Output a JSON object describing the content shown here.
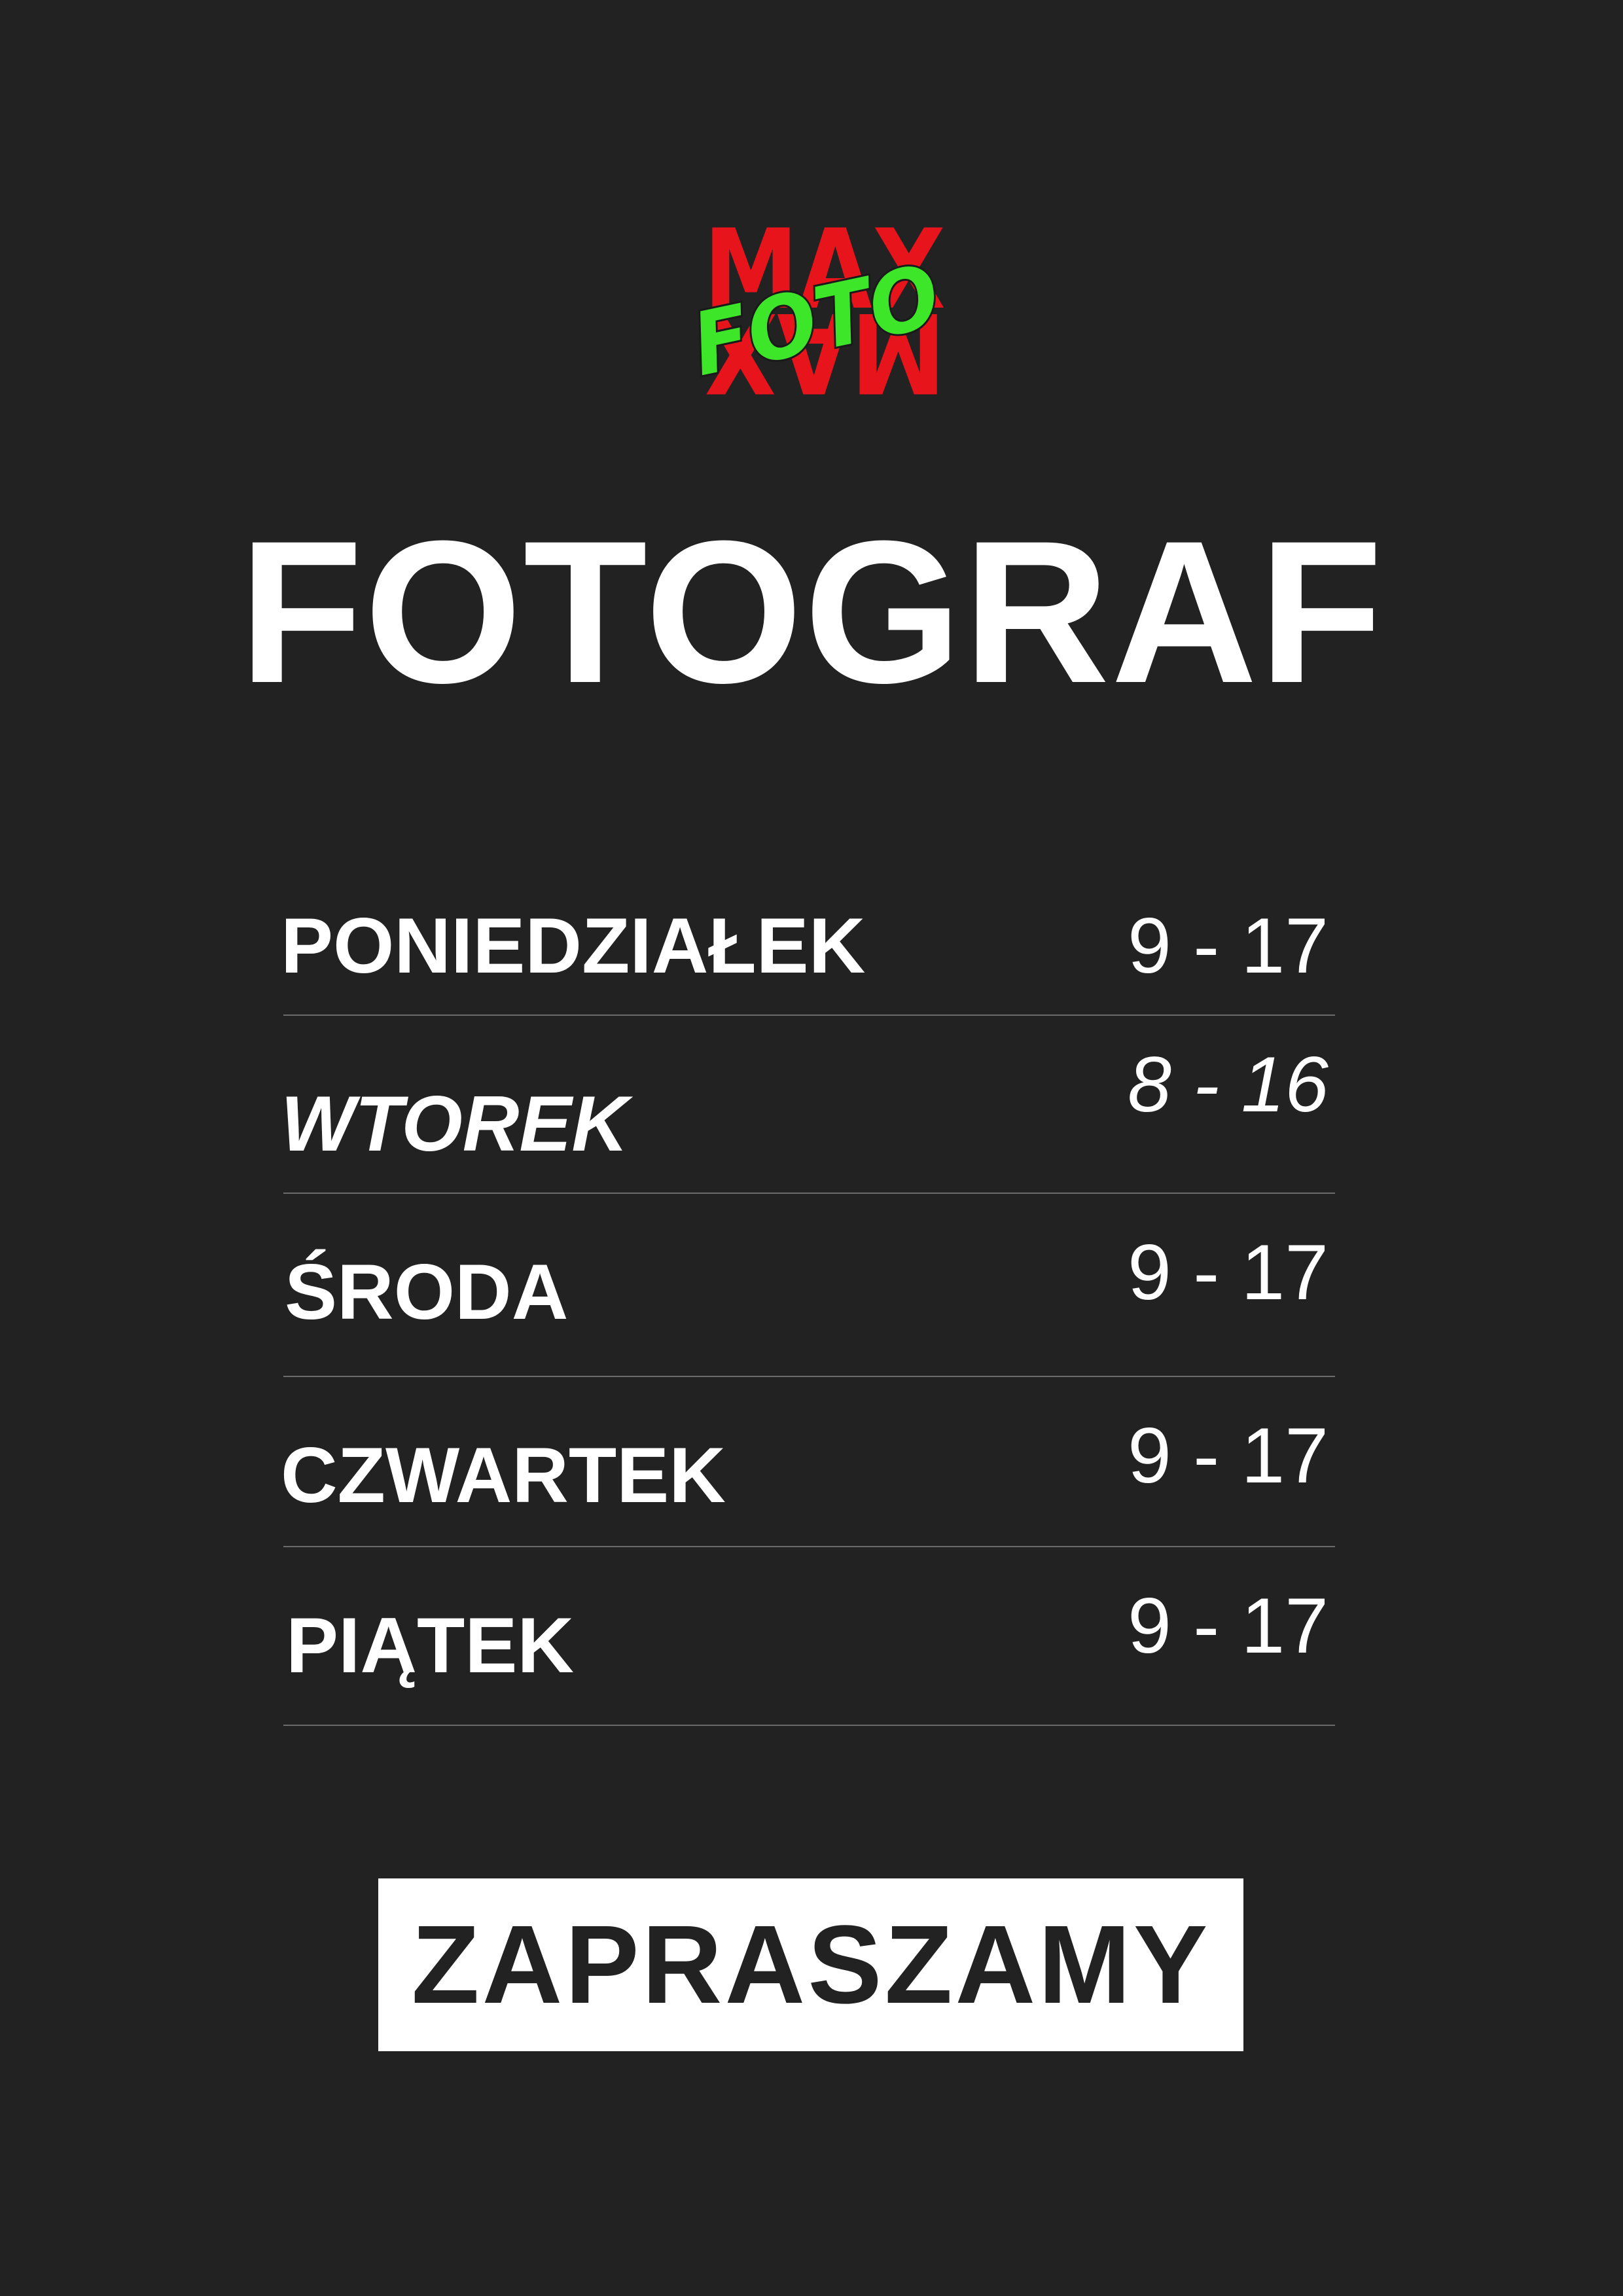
{
  "logo": {
    "name": "foto-max-logo",
    "word_red": "MAX",
    "word_green": "FOTO",
    "colors": {
      "red": "#e8141b",
      "green": "#3ee62a",
      "outline": "#1a1a1a"
    }
  },
  "title": "FOTOGRAF",
  "schedule": [
    {
      "day": "PONIEDZIAŁEK",
      "hours": "9 - 17"
    },
    {
      "day": "WTOREK",
      "hours": "8 - 16"
    },
    {
      "day": "ŚRODA",
      "hours": "9 - 17"
    },
    {
      "day": "CZWARTEK",
      "hours": "9 - 17"
    },
    {
      "day": "PIĄTEK",
      "hours": "9 - 17"
    }
  ],
  "cta": "ZAPRASZAMY",
  "colors": {
    "background": "#222222",
    "text": "#ffffff",
    "divider": "#6b6b6b"
  }
}
